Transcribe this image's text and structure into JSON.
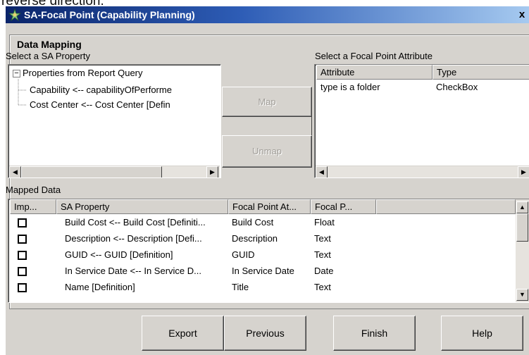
{
  "background_text": "reverse direction.",
  "window": {
    "title": "SA-Focal Point (Capability Planning)",
    "close_label": "x"
  },
  "group": {
    "legend": "Data Mapping",
    "sa_property_label": "Select a SA Property",
    "focal_point_label": "Select a Focal Point Attribute",
    "mapped_data_label": "Mapped Data"
  },
  "tree": {
    "root": "Properties from Report Query",
    "root_expander": "−",
    "children": [
      "Capability <-- capabilityOfPerforme",
      "Cost Center <-- Cost Center [Defin"
    ]
  },
  "actions": {
    "map": "Map",
    "unmap": "Unmap"
  },
  "attributes": {
    "headers": [
      "Attribute",
      "Type"
    ],
    "rows": [
      {
        "attribute": "type is a folder",
        "type": "CheckBox"
      }
    ]
  },
  "mapped": {
    "headers": [
      "Imp...",
      "SA Property",
      "Focal Point At...",
      "Focal P..."
    ],
    "rows": [
      {
        "imported": false,
        "sa_property": "Build Cost <-- Build Cost [Definiti...",
        "focal_point_attribute": "Build Cost",
        "focal_point_type": "Float"
      },
      {
        "imported": false,
        "sa_property": "Description <-- Description [Defi...",
        "focal_point_attribute": "Description",
        "focal_point_type": "Text"
      },
      {
        "imported": false,
        "sa_property": "GUID <-- GUID [Definition]",
        "focal_point_attribute": "GUID",
        "focal_point_type": "Text"
      },
      {
        "imported": false,
        "sa_property": "In Service Date <-- In Service D...",
        "focal_point_attribute": "In Service Date",
        "focal_point_type": "Date"
      },
      {
        "imported": false,
        "sa_property": "Name [Definition]",
        "focal_point_attribute": "Title",
        "focal_point_type": "Text"
      }
    ]
  },
  "footer": {
    "export": "Export",
    "previous": "Previous",
    "finish": "Finish",
    "help": "Help"
  },
  "icons": {
    "app": "sa-app-icon",
    "scroll_left": "arrow-left-icon",
    "scroll_right": "arrow-right-icon",
    "scroll_up": "arrow-up-icon",
    "scroll_down": "arrow-down-icon"
  },
  "colors": {
    "dialog_bg": "#d6d3ce",
    "title_start": "#0a246a",
    "title_end": "#a6caf0",
    "disabled_text": "#a09d98"
  }
}
